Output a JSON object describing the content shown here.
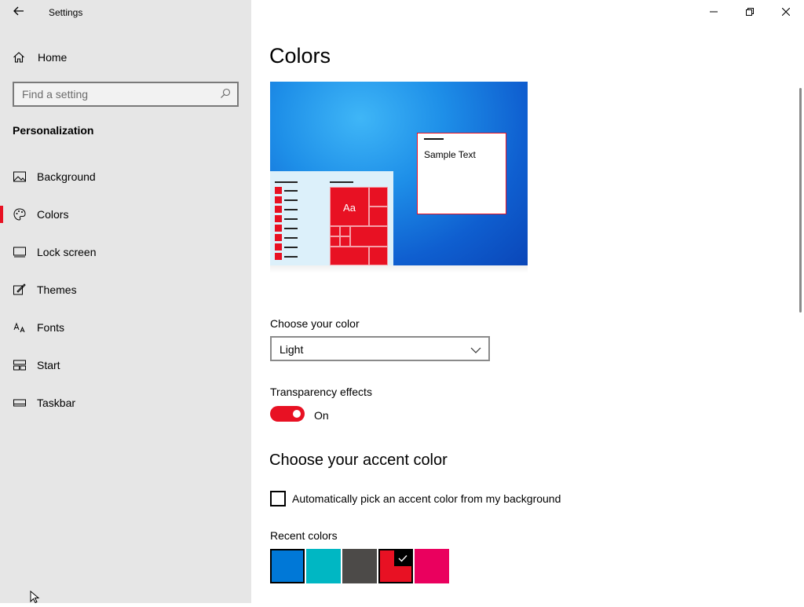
{
  "window": {
    "title": "Settings"
  },
  "sidebar": {
    "home_label": "Home",
    "search": {
      "placeholder": "Find a setting",
      "value": ""
    },
    "section_title": "Personalization",
    "items": [
      {
        "label": "Background",
        "icon": "image-icon"
      },
      {
        "label": "Colors",
        "icon": "palette-icon",
        "active": true
      },
      {
        "label": "Lock screen",
        "icon": "lock-screen-icon"
      },
      {
        "label": "Themes",
        "icon": "themes-brush-icon"
      },
      {
        "label": "Fonts",
        "icon": "fonts-icon"
      },
      {
        "label": "Start",
        "icon": "start-layout-icon"
      },
      {
        "label": "Taskbar",
        "icon": "taskbar-icon"
      }
    ]
  },
  "main": {
    "title": "Colors",
    "preview": {
      "sample_text": "Sample Text",
      "tile_label": "Aa"
    },
    "choose_color": {
      "label": "Choose your color",
      "selected": "Light"
    },
    "transparency": {
      "label": "Transparency effects",
      "state": "On",
      "enabled": true
    },
    "accent_heading": "Choose your accent color",
    "auto_accent": {
      "label": "Automatically pick an accent color from my background",
      "checked": false
    },
    "recent_colors": {
      "label": "Recent colors",
      "swatches": [
        {
          "color": "#0078d7",
          "selected": false
        },
        {
          "color": "#00b7c3",
          "selected": false
        },
        {
          "color": "#4c4a48",
          "selected": false
        },
        {
          "color": "#e81123",
          "selected": true
        },
        {
          "color": "#ea005e",
          "selected": false
        }
      ]
    }
  },
  "colors": {
    "accent": "#e81123",
    "sidebar_bg": "#e6e6e6"
  }
}
